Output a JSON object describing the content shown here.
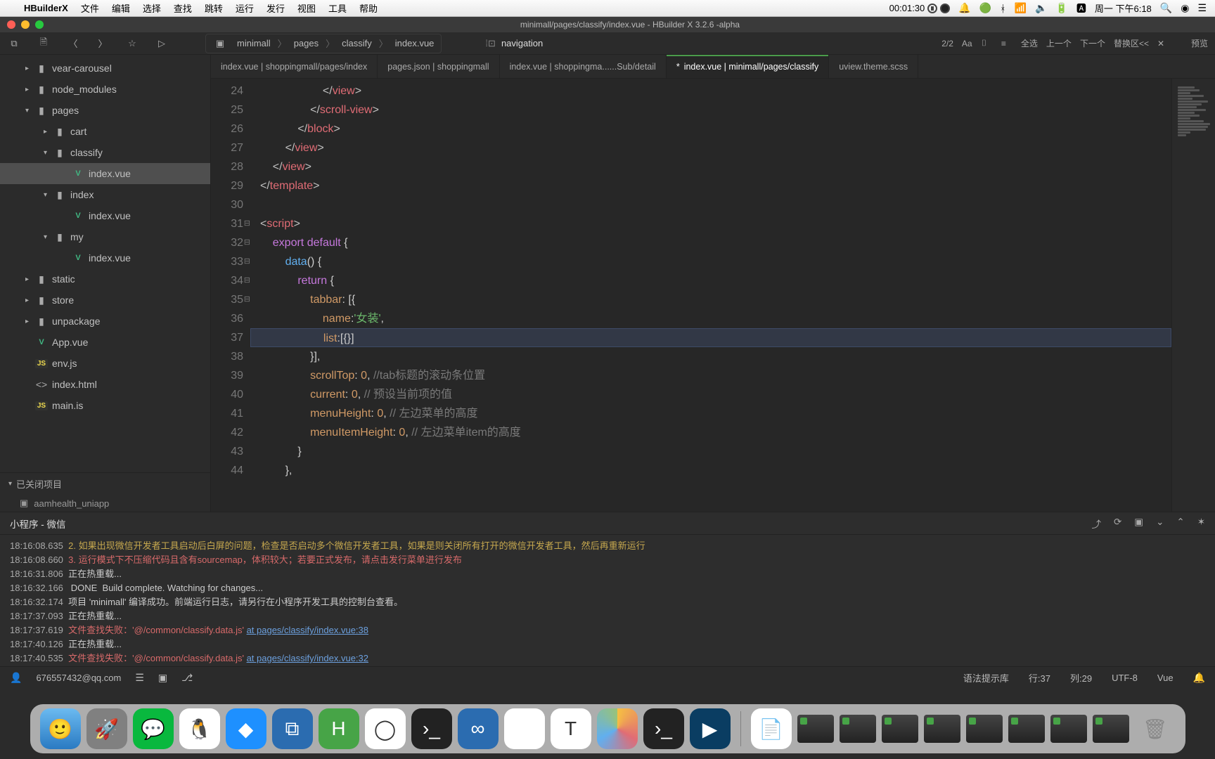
{
  "mac": {
    "appName": "HBuilderX",
    "menus": [
      "文件",
      "编辑",
      "选择",
      "查找",
      "跳转",
      "运行",
      "发行",
      "视图",
      "工具",
      "帮助"
    ],
    "recTime": "00:01:30",
    "clock": "周一 下午6:18"
  },
  "window": {
    "title": "minimall/pages/classify/index.vue - HBuilder X 3.2.6 -alpha"
  },
  "breadcrumb": [
    "minimall",
    "pages",
    "classify",
    "index.vue"
  ],
  "search": {
    "icon": "search-icon",
    "value": "navigation"
  },
  "findbar": {
    "count": "2/2",
    "selectAll": "全选",
    "prev": "上一个",
    "next": "下一个",
    "replaceArea": "替换区<<",
    "preview": "预览"
  },
  "tree": [
    {
      "indent": 1,
      "twist": ">",
      "icon": "folder",
      "label": "vear-carousel"
    },
    {
      "indent": 1,
      "twist": ">",
      "icon": "folder",
      "label": "node_modules"
    },
    {
      "indent": 1,
      "twist": "v",
      "icon": "folder",
      "label": "pages"
    },
    {
      "indent": 2,
      "twist": ">",
      "icon": "folder",
      "label": "cart"
    },
    {
      "indent": 2,
      "twist": "v",
      "icon": "folder",
      "label": "classify"
    },
    {
      "indent": 3,
      "twist": "",
      "icon": "vue",
      "label": "index.vue",
      "selected": true
    },
    {
      "indent": 2,
      "twist": "v",
      "icon": "folder",
      "label": "index"
    },
    {
      "indent": 3,
      "twist": "",
      "icon": "vue",
      "label": "index.vue"
    },
    {
      "indent": 2,
      "twist": "v",
      "icon": "folder",
      "label": "my"
    },
    {
      "indent": 3,
      "twist": "",
      "icon": "vue",
      "label": "index.vue"
    },
    {
      "indent": 1,
      "twist": ">",
      "icon": "folder",
      "label": "static"
    },
    {
      "indent": 1,
      "twist": ">",
      "icon": "folder",
      "label": "store"
    },
    {
      "indent": 1,
      "twist": ">",
      "icon": "folder",
      "label": "unpackage"
    },
    {
      "indent": 1,
      "twist": "",
      "icon": "vue",
      "label": "App.vue"
    },
    {
      "indent": 1,
      "twist": "",
      "icon": "js",
      "label": "env.js"
    },
    {
      "indent": 1,
      "twist": "",
      "icon": "html",
      "label": "index.html"
    },
    {
      "indent": 1,
      "twist": "",
      "icon": "js",
      "label": "main.is"
    }
  ],
  "closedProjects": {
    "header": "已关闭项目",
    "items": [
      "aamhealth_uniapp"
    ]
  },
  "tabs": [
    {
      "label": "index.vue | shoppingmall/pages/index"
    },
    {
      "label": "pages.json | shoppingmall"
    },
    {
      "label": "index.vue | shoppingma......Sub/detail"
    },
    {
      "label": "index.vue | minimall/pages/classify",
      "active": true,
      "dirty": true
    },
    {
      "label": "uview.theme.scss"
    }
  ],
  "code": {
    "startLine": 24,
    "lines": [
      {
        "n": 24,
        "html": "                    &lt;/<span class='tag'>view</span>&gt;"
      },
      {
        "n": 25,
        "html": "                &lt;/<span class='tag'>scroll-view</span>&gt;"
      },
      {
        "n": 26,
        "html": "            &lt;/<span class='tag'>block</span>&gt;"
      },
      {
        "n": 27,
        "html": "        &lt;/<span class='tag'>view</span>&gt;"
      },
      {
        "n": 28,
        "html": "    &lt;/<span class='tag'>view</span>&gt;"
      },
      {
        "n": 29,
        "html": "&lt;/<span class='tag'>template</span>&gt;"
      },
      {
        "n": 30,
        "html": ""
      },
      {
        "n": 31,
        "html": "&lt;<span class='tag'>script</span>&gt;",
        "fold": true
      },
      {
        "n": 32,
        "html": "    <span class='kw1'>export</span> <span class='kw1'>default</span> <span class='punct'>{</span>",
        "fold": true
      },
      {
        "n": 33,
        "html": "        <span class='kw2'>data</span><span class='punct'>()</span> <span class='punct'>{</span>",
        "fold": true
      },
      {
        "n": 34,
        "html": "            <span class='kw1'>return</span> <span class='punct'>{</span>",
        "fold": true
      },
      {
        "n": 35,
        "html": "                <span class='prop'>tabbar</span><span class='punct'>:</span> <span class='punct'>[{</span>",
        "fold": true,
        "mod": true
      },
      {
        "n": 36,
        "html": "                    <span class='prop'>name</span><span class='punct'>:</span><span class='str'>'女装'</span><span class='punct'>,</span>",
        "mod": true
      },
      {
        "n": 37,
        "html": "                    <span class='prop'>list</span><span class='punct'>:</span><span class='punct'>[{}</span><span class='punct'>]</span>",
        "hl": true,
        "mod": true
      },
      {
        "n": 38,
        "html": "                <span class='punct'>}],</span>",
        "mod": true
      },
      {
        "n": 39,
        "html": "                <span class='prop'>scrollTop</span><span class='punct'>:</span> <span class='num'>0</span><span class='punct'>,</span> <span class='cmt'>//tab标题的滚动条位置</span>"
      },
      {
        "n": 40,
        "html": "                <span class='prop'>current</span><span class='punct'>:</span> <span class='num'>0</span><span class='punct'>,</span> <span class='cmt'>// 预设当前项的值</span>"
      },
      {
        "n": 41,
        "html": "                <span class='prop'>menuHeight</span><span class='punct'>:</span> <span class='num'>0</span><span class='punct'>,</span> <span class='cmt'>// 左边菜单的高度</span>"
      },
      {
        "n": 42,
        "html": "                <span class='prop'>menuItemHeight</span><span class='punct'>:</span> <span class='num'>0</span><span class='punct'>,</span> <span class='cmt'>// 左边菜单item的高度</span>"
      },
      {
        "n": 43,
        "html": "            <span class='punct'>}</span>"
      },
      {
        "n": 44,
        "html": "        <span class='punct'>},</span>"
      }
    ]
  },
  "console": {
    "title": "小程序 - 微信",
    "lines": [
      {
        "ts": "18:16:08.635",
        "cls": "warn",
        "text": "2. 如果出现微信开发者工具启动后白屏的问题，检查是否启动多个微信开发者工具，如果是则关闭所有打开的微信开发者工具，然后再重新运行"
      },
      {
        "ts": "18:16:08.660",
        "cls": "err",
        "text": "3. 运行模式下不压缩代码且含有sourcemap，体积较大；若要正式发布，请点击发行菜单进行发布"
      },
      {
        "ts": "18:16:31.806",
        "cls": "info",
        "text": "正在热重载..."
      },
      {
        "ts": "18:16:32.166",
        "cls": "info",
        "text": " DONE  Build complete. Watching for changes..."
      },
      {
        "ts": "18:16:32.174",
        "cls": "info",
        "text": "项目 'minimall' 编译成功。前端运行日志，请另行在小程序开发工具的控制台查看。"
      },
      {
        "ts": "18:17:37.093",
        "cls": "info",
        "text": "正在热重载..."
      },
      {
        "ts": "18:17:37.619",
        "cls": "err",
        "text": "文件查找失败：'@/common/classify.data.js' ",
        "link": "at pages/classify/index.vue:38"
      },
      {
        "ts": "18:17:40.126",
        "cls": "info",
        "text": "正在热重载..."
      },
      {
        "ts": "18:17:40.535",
        "cls": "err",
        "text": "文件查找失败：'@/common/classify.data.js' ",
        "link": "at pages/classify/index.vue:32"
      }
    ]
  },
  "statusbar": {
    "user": "676557432@qq.com",
    "syntax": "语法提示库",
    "line": "行:37",
    "col": "列:29",
    "encoding": "UTF-8",
    "lang": "Vue"
  }
}
